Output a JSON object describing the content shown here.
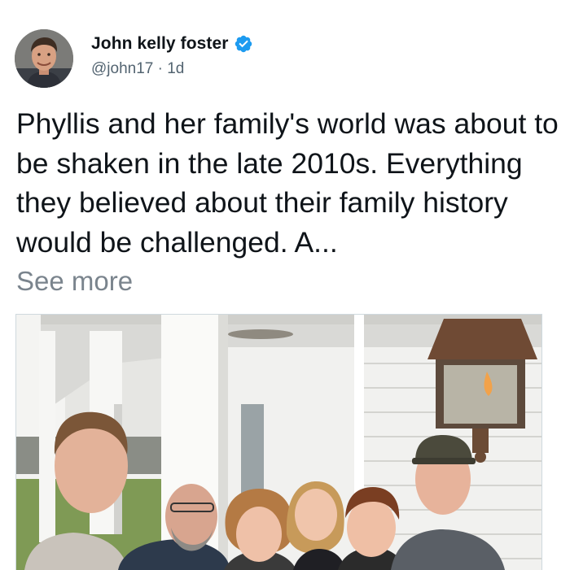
{
  "post": {
    "author_name": "John kelly foster",
    "author_handle": "@john17",
    "separator": "·",
    "timestamp": "1d",
    "verified": true,
    "text": "Phyllis and her family's world was about to be shaken in the late 2010s. Everything they believed about their family history would be challenged. A...",
    "see_more_label": "See more"
  },
  "icons": {
    "verified": "verified-badge-icon"
  },
  "colors": {
    "verified_blue": "#1d9bf0",
    "text_primary": "#0f1419",
    "text_secondary": "#536471",
    "see_more": "#7a848d"
  }
}
